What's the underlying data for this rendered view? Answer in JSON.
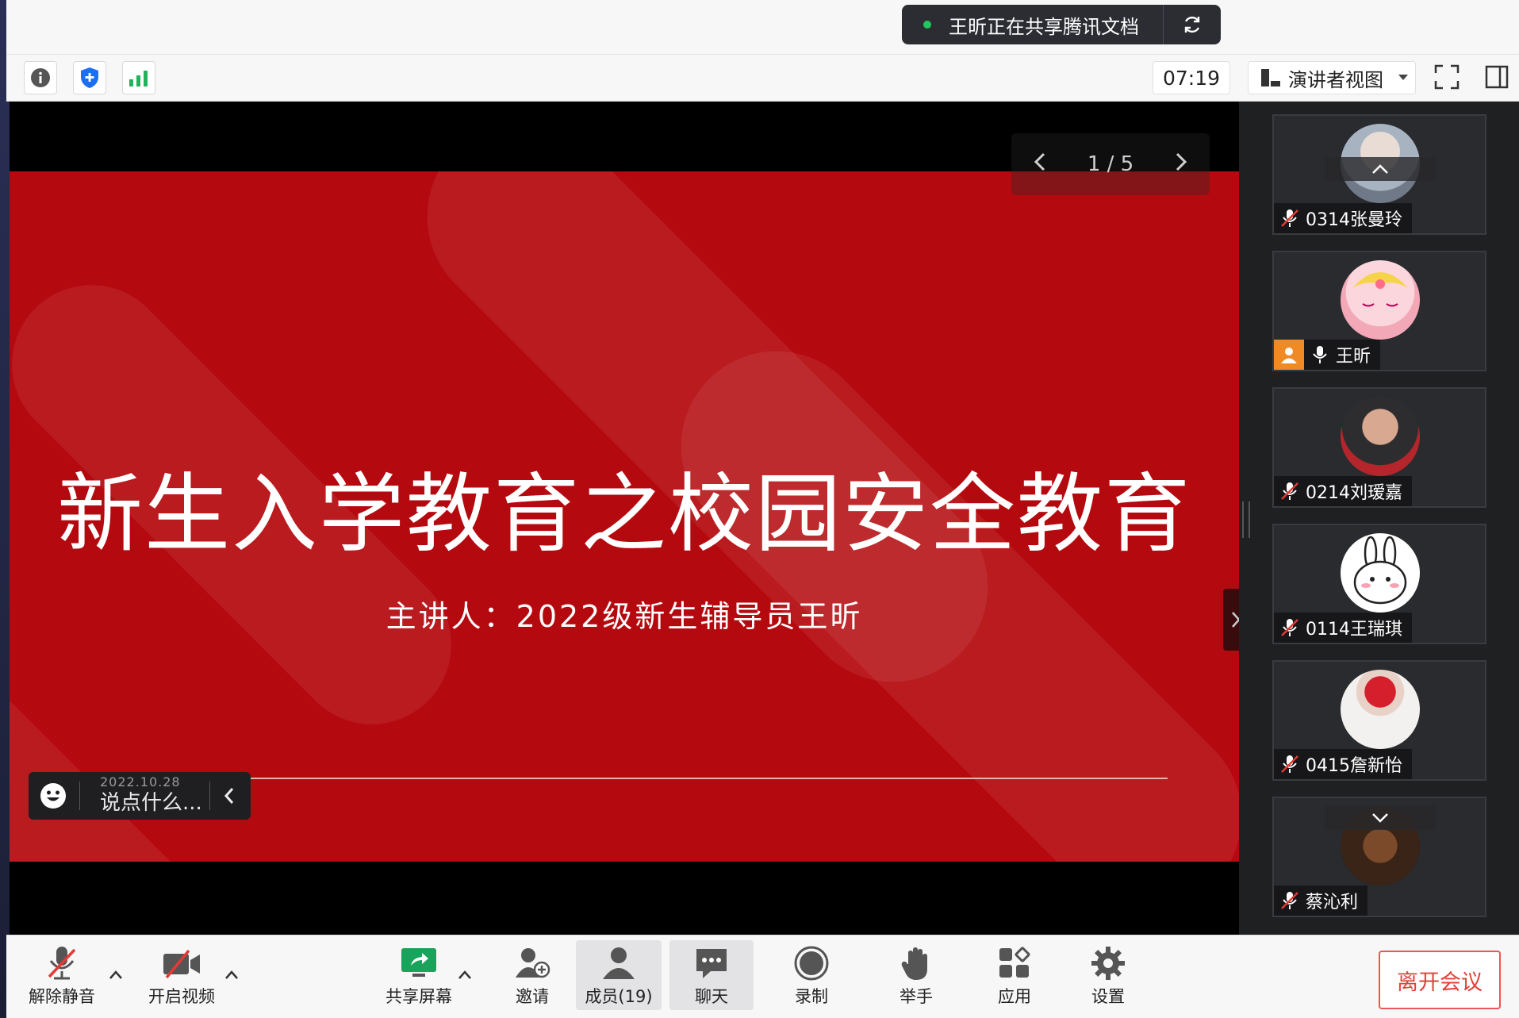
{
  "share_banner": {
    "text": "王昕正在共享腾讯文档",
    "icon": "refresh-icon"
  },
  "toolbar": {
    "icons": [
      "info-icon",
      "shield-icon",
      "signal-icon"
    ],
    "timer": "07:19",
    "view_label": "演讲者视图",
    "fullscreen_icon": "fullscreen-icon",
    "panel_icon": "panel-toggle-icon"
  },
  "slide": {
    "title": "新生入学教育之校园安全教育",
    "subtitle": "主讲人：2022级新生辅导员王昕",
    "page_indicator": "1 / 5"
  },
  "chat": {
    "date": "2022.10.28",
    "placeholder": "说点什么..."
  },
  "participants": [
    {
      "name": "0314张曼玲",
      "mic": "muted",
      "host": false
    },
    {
      "name": "王昕",
      "mic": "on",
      "host": true
    },
    {
      "name": "0214刘瑷嘉",
      "mic": "muted",
      "host": false
    },
    {
      "name": "0114王瑞琪",
      "mic": "muted",
      "host": false
    },
    {
      "name": "0415詹新怡",
      "mic": "muted",
      "host": false
    },
    {
      "name": "蔡沁利",
      "mic": "muted",
      "host": false
    }
  ],
  "bottom": {
    "unmute": "解除静音",
    "video": "开启视频",
    "share": "共享屏幕",
    "invite": "邀请",
    "members": "成员(19)",
    "chat": "聊天",
    "record": "录制",
    "raise_hand": "举手",
    "apps": "应用",
    "settings": "设置",
    "leave": "离开会议"
  },
  "colors": {
    "slide_red": "#b40a0f",
    "accent_green": "#23c55e",
    "leave_red": "#e0423a",
    "host_orange": "#f08a24"
  }
}
